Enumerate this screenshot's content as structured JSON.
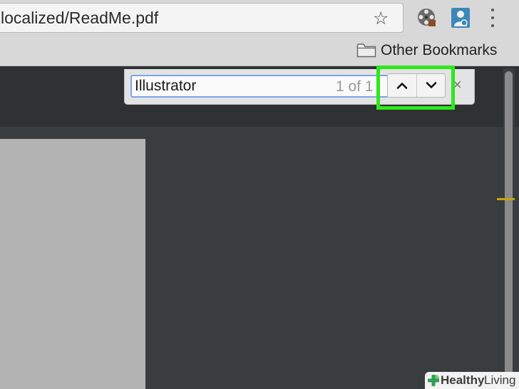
{
  "browser": {
    "address_bar": {
      "url": "localized/ReadMe.pdf"
    },
    "icons": {
      "bookmark": "star-icon",
      "extension_1": "film-reel-icon",
      "extension_2": "person-badge-icon",
      "menu": "vertical-dots-icon"
    },
    "bookmarks_bar": {
      "items": [
        {
          "icon": "folder-icon",
          "label": "Other Bookmarks"
        }
      ]
    }
  },
  "find_bar": {
    "query": "Illustrator",
    "match_count": "1 of 1",
    "buttons": {
      "previous": "chevron-up-icon",
      "next": "chevron-down-icon",
      "close": "×"
    }
  },
  "annotation": {
    "highlight_color": "#2ee81c"
  },
  "watermark": {
    "brand": "Healthy",
    "suffix": "Living"
  },
  "colors": {
    "viewer_background": "#3a3d40",
    "viewer_toolbar": "#2f3133",
    "pdf_page": "#b3b3b3",
    "scroll_match_marker": "#c8a400"
  }
}
